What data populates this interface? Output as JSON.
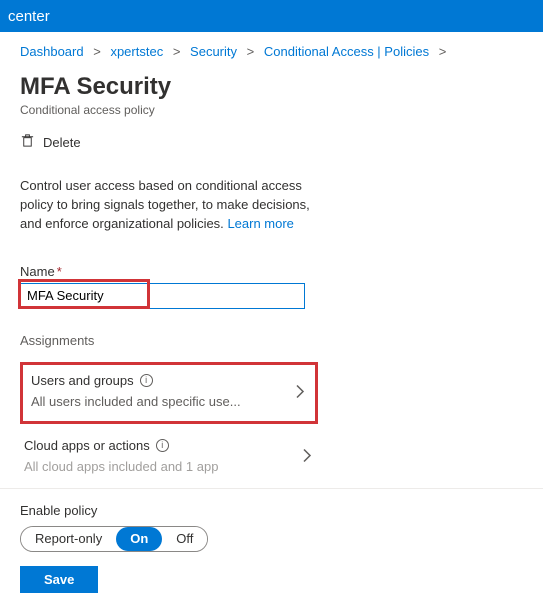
{
  "topbar": {
    "title": "center"
  },
  "breadcrumb": {
    "items": [
      "Dashboard",
      "xpertstec",
      "Security",
      "Conditional Access | Policies"
    ]
  },
  "page": {
    "title": "MFA Security",
    "subtitle": "Conditional access policy",
    "delete_label": "Delete",
    "description": "Control user access based on conditional access policy to bring signals together, to make decisions, and enforce organizational policies.",
    "learn_more": "Learn more"
  },
  "form": {
    "name_label": "Name",
    "name_value": "MFA Security",
    "assignments_label": "Assignments",
    "users_groups": {
      "title": "Users and groups",
      "subtitle": "All users included and specific use..."
    },
    "cloud_apps": {
      "title": "Cloud apps or actions",
      "subtitle": "All cloud apps included and 1 app"
    }
  },
  "footer": {
    "enable_label": "Enable policy",
    "options": {
      "report": "Report-only",
      "on": "On",
      "off": "Off"
    },
    "save": "Save"
  }
}
